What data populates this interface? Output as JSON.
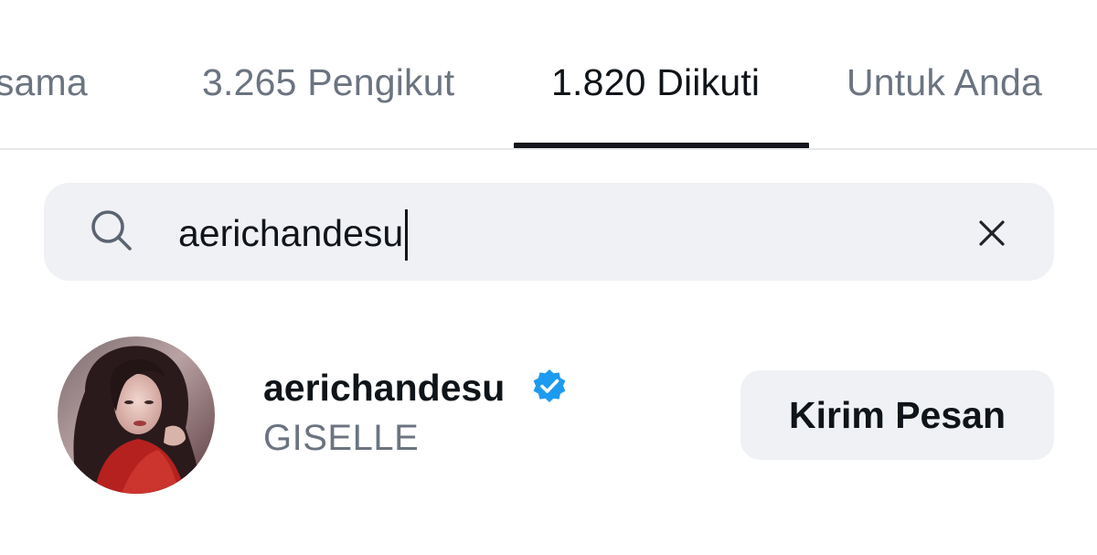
{
  "tabs": [
    {
      "label": "ersama",
      "active": false
    },
    {
      "label": "3.265 Pengikut",
      "active": false
    },
    {
      "label": "1.820 Diikuti",
      "active": true
    },
    {
      "label": "Untuk Anda",
      "active": false
    }
  ],
  "search": {
    "value": "aerichandesu",
    "icon": "search-icon",
    "clear_icon": "close-icon"
  },
  "result": {
    "username": "aerichandesu",
    "display_name": "GISELLE",
    "verified": true,
    "verified_icon": "verified-badge-icon",
    "action_label": "Kirim Pesan"
  },
  "colors": {
    "active_tab": "#0f1419",
    "inactive_tab": "#6b7480",
    "verified_blue": "#1d9bf0",
    "field_bg": "#eff1f5"
  }
}
